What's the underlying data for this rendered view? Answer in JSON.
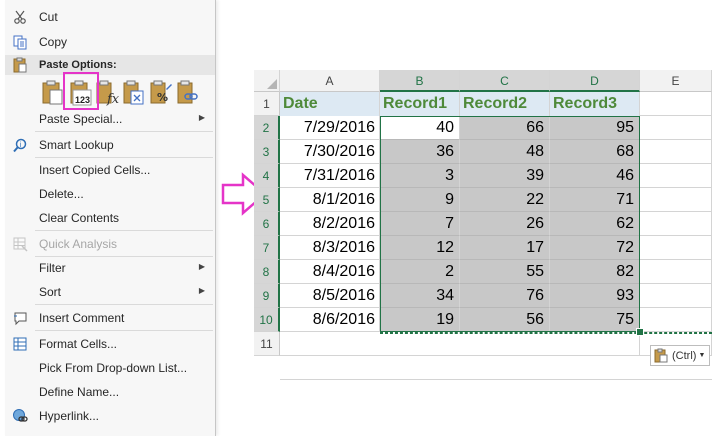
{
  "menu": {
    "cut": "Cut",
    "copy": "Copy",
    "paste_options": "Paste Options:",
    "paste_special": "Paste Special...",
    "smart_lookup": "Smart Lookup",
    "insert_copied_cells": "Insert Copied Cells...",
    "delete": "Delete...",
    "clear_contents": "Clear Contents",
    "quick_analysis": "Quick Analysis",
    "filter": "Filter",
    "sort": "Sort",
    "insert_comment": "Insert Comment",
    "format_cells": "Format Cells...",
    "pick_from_list": "Pick From Drop-down List...",
    "define_name": "Define Name...",
    "hyperlink": "Hyperlink..."
  },
  "paste_icons": [
    "paste-icon",
    "paste-values-icon",
    "paste-formulas-icon",
    "paste-transpose-icon",
    "paste-formatting-icon",
    "paste-link-icon"
  ],
  "paste_values_label": "123",
  "sheet": {
    "columns": [
      "A",
      "B",
      "C",
      "D",
      "E"
    ],
    "rows": [
      "1",
      "2",
      "3",
      "4",
      "5",
      "6",
      "7",
      "8",
      "9",
      "10",
      "11"
    ],
    "headers": [
      "Date",
      "Record1",
      "Record2",
      "Record3"
    ],
    "data": [
      [
        "7/29/2016",
        "40",
        "66",
        "95"
      ],
      [
        "7/30/2016",
        "36",
        "48",
        "68"
      ],
      [
        "7/31/2016",
        "3",
        "39",
        "46"
      ],
      [
        "8/1/2016",
        "9",
        "22",
        "71"
      ],
      [
        "8/2/2016",
        "7",
        "26",
        "62"
      ],
      [
        "8/3/2016",
        "12",
        "17",
        "72"
      ],
      [
        "8/4/2016",
        "2",
        "55",
        "82"
      ],
      [
        "8/5/2016",
        "34",
        "76",
        "93"
      ],
      [
        "8/6/2016",
        "19",
        "56",
        "75"
      ]
    ]
  },
  "paste_ctrl": "(Ctrl)",
  "colors": {
    "header_fill": "#dde9f3",
    "header_text": "#4e8a3a",
    "selection_fill": "#c8c8c8",
    "accent_green": "#217346",
    "highlight_magenta": "#e534c8"
  }
}
